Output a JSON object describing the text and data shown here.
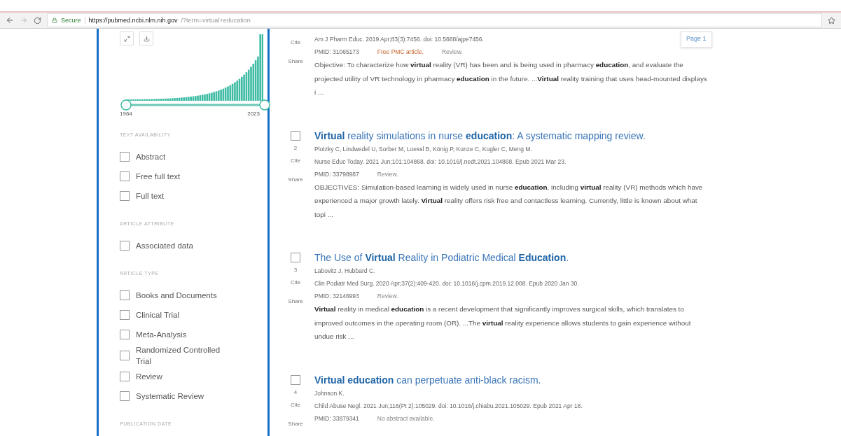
{
  "browser": {
    "secure_label": "Secure",
    "url_host": "https://pubmed.ncbi.nlm.nih.gov",
    "url_path": "/?term=virtual+education"
  },
  "sidebar": {
    "year_range": {
      "start": "1964",
      "end": "2023",
      "thumbs": [
        {
          "level": 0
        },
        {
          "level": 1
        }
      ]
    },
    "sections": [
      {
        "heading": "TEXT AVAILABILITY",
        "filters": [
          {
            "label": "Abstract",
            "checked": false
          },
          {
            "label": "Free full text",
            "checked": false
          },
          {
            "label": "Full text",
            "checked": false
          }
        ]
      },
      {
        "heading": "ARTICLE ATTRIBUTE",
        "filters": [
          {
            "label": "Associated data",
            "checked": false
          }
        ]
      },
      {
        "heading": "ARTICLE TYPE",
        "filters": [
          {
            "label": "Books and Documents",
            "checked": false
          },
          {
            "label": "Clinical Trial",
            "checked": false
          },
          {
            "label": "Meta-Analysis",
            "checked": false
          },
          {
            "label": "Randomized Controlled Trial",
            "checked": false
          },
          {
            "label": "Review",
            "checked": false
          },
          {
            "label": "Systematic Review",
            "checked": false
          }
        ]
      },
      {
        "heading": "PUBLICATION DATE"
      }
    ]
  },
  "page_badge": "Page 1",
  "results": [
    {
      "citation": "Am J Pharm Educ. 2019 Apr;83(3):7456. doi: 10.5688/ajpe7456.",
      "pmid": "PMID: 31065173",
      "tags": [
        {
          "kind": "free",
          "text": "Free PMC article."
        },
        {
          "kind": "type",
          "text": "Review."
        }
      ],
      "snippet": "Objective: To characterize how **virtual** reality (VR) has been and is being used in pharmacy **education**, and evaluate the projected utility of VR technology in pharmacy **education** in the future. ...**Virtual** reality training that uses head-mounted displays i ...",
      "cite": "Cite",
      "share": "Share"
    },
    {
      "checked": false,
      "number": "2",
      "title": "**Virtual** reality simulations in nurse **education**: A systematic mapping review.",
      "authors": "Plotzky C, Lindwedel U, Sorber M, Loessl B, König P, Kunze C, Kugler C, Meng M.",
      "citation": "Nurse Educ Today. 2021 Jun;101:104868. doi: 10.1016/j.nedt.2021.104868. Epub 2021 Mar 23.",
      "pmid": "PMID: 33798987",
      "tags": [
        {
          "kind": "type",
          "text": "Review."
        }
      ],
      "snippet": "OBJECTIVES: Simulation-based learning is widely used in nurse **education**, including **virtual** reality (VR) methods which have experienced a major growth lately. **Virtual** reality offers risk free and contactless learning. Currently, little is known about what topi ...",
      "cite": "Cite",
      "share": "Share"
    },
    {
      "checked": false,
      "number": "3",
      "title": "The Use of **Virtual** Reality in Podiatric Medical **Education**.",
      "authors": "Labovitz J, Hubbard C.",
      "citation": "Clin Podiatr Med Surg. 2020 Apr;37(2):409-420. doi: 10.1016/j.cpm.2019.12.008. Epub 2020 Jan 30.",
      "pmid": "PMID: 32146993",
      "tags": [
        {
          "kind": "type",
          "text": "Review."
        }
      ],
      "snippet": "**Virtual** reality in medical **education** is a recent development that significantly improves surgical skills, which translates to improved outcomes in the operating room (OR). ...The **virtual** reality experience allows students to gain experience without undue risk ...",
      "cite": "Cite",
      "share": "Share"
    },
    {
      "checked": false,
      "number": "4",
      "title": "**Virtual education** can perpetuate anti-black racism.",
      "authors": "Johnson K.",
      "citation": "Child Abuse Negl. 2021 Jun;116(Pt 2):105029. doi: 10.1016/j.chiabu.2021.105029. Epub 2021 Apr 18.",
      "pmid": "PMID: 33879341",
      "tags": [
        {
          "kind": "note",
          "text": "No abstract available."
        }
      ],
      "cite": "Cite",
      "share": "Share"
    }
  ]
}
